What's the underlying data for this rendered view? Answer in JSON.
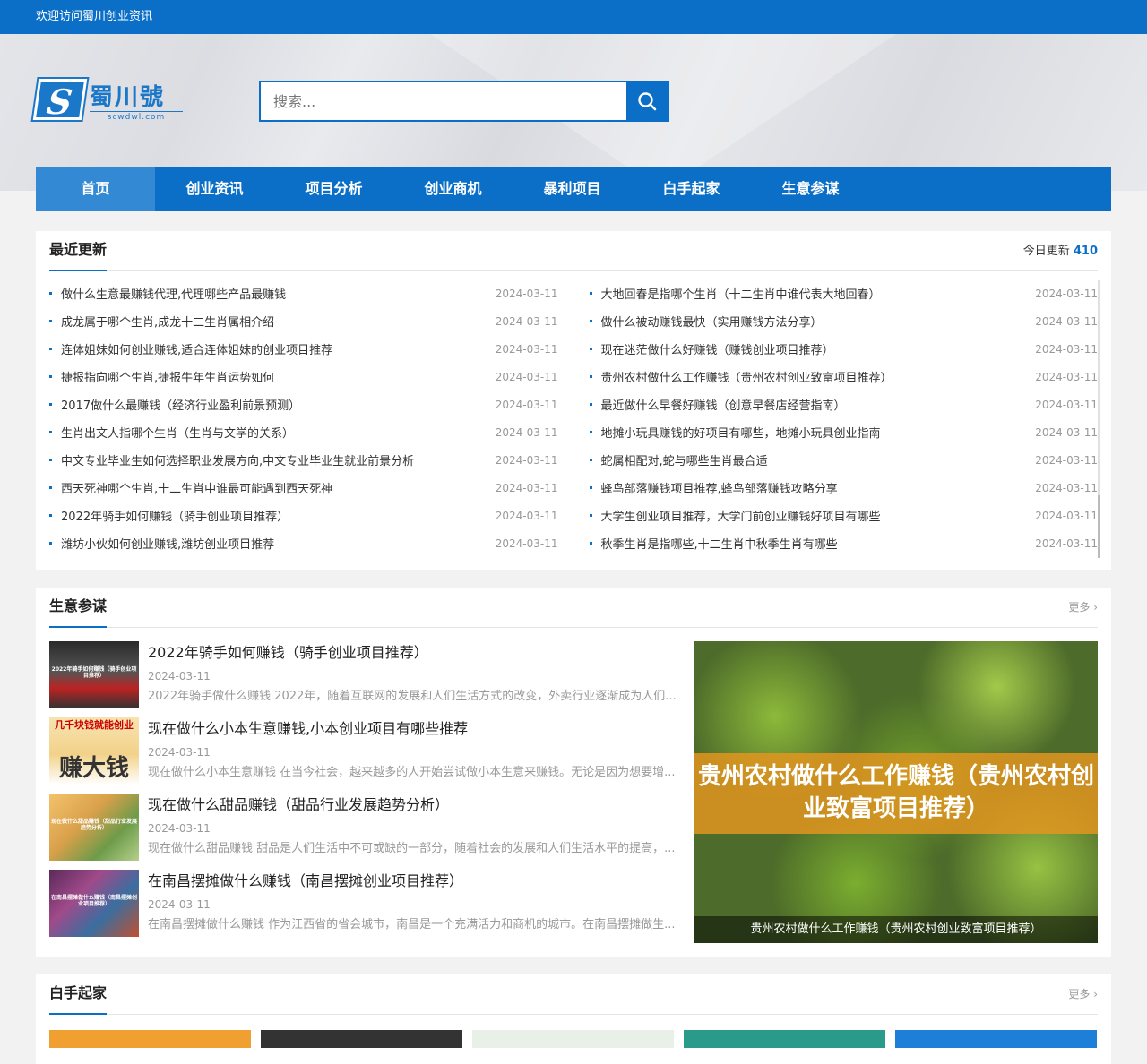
{
  "topbar": {
    "welcome": "欢迎访问蜀川创业资讯"
  },
  "logo": {
    "mark": "S",
    "name": "蜀川號",
    "domain": "scwdwl.com"
  },
  "search": {
    "placeholder": "搜索..."
  },
  "nav": [
    "首页",
    "创业资讯",
    "项目分析",
    "创业商机",
    "暴利项目",
    "白手起家",
    "生意参谋"
  ],
  "recent": {
    "title": "最近更新",
    "today_label": "今日更新",
    "today_count": "410",
    "left": [
      {
        "title": "做什么生意最赚钱代理,代理哪些产品最赚钱",
        "date": "2024-03-11"
      },
      {
        "title": "成龙属于哪个生肖,成龙十二生肖属相介绍",
        "date": "2024-03-11"
      },
      {
        "title": "连体姐妹如何创业赚钱,适合连体姐妹的创业项目推荐",
        "date": "2024-03-11"
      },
      {
        "title": "捷报指向哪个生肖,捷报牛年生肖运势如何",
        "date": "2024-03-11"
      },
      {
        "title": "2017做什么最赚钱（经济行业盈利前景预测）",
        "date": "2024-03-11"
      },
      {
        "title": "生肖出文人指哪个生肖（生肖与文学的关系）",
        "date": "2024-03-11"
      },
      {
        "title": "中文专业毕业生如何选择职业发展方向,中文专业毕业生就业前景分析",
        "date": "2024-03-11"
      },
      {
        "title": "西天死神哪个生肖,十二生肖中谁最可能遇到西天死神",
        "date": "2024-03-11"
      },
      {
        "title": "2022年骑手如何赚钱（骑手创业项目推荐）",
        "date": "2024-03-11"
      },
      {
        "title": "潍坊小伙如何创业赚钱,潍坊创业项目推荐",
        "date": "2024-03-11"
      }
    ],
    "right": [
      {
        "title": "大地回春是指哪个生肖（十二生肖中谁代表大地回春）",
        "date": "2024-03-11"
      },
      {
        "title": "做什么被动赚钱最快（实用赚钱方法分享）",
        "date": "2024-03-11"
      },
      {
        "title": "现在迷茫做什么好赚钱（赚钱创业项目推荐）",
        "date": "2024-03-11"
      },
      {
        "title": "贵州农村做什么工作赚钱（贵州农村创业致富项目推荐）",
        "date": "2024-03-11"
      },
      {
        "title": "最近做什么早餐好赚钱（创意早餐店经营指南）",
        "date": "2024-03-11"
      },
      {
        "title": "地摊小玩具赚钱的好项目有哪些，地摊小玩具创业指南",
        "date": "2024-03-11"
      },
      {
        "title": "蛇属相配对,蛇与哪些生肖最合适",
        "date": "2024-03-11"
      },
      {
        "title": "蜂鸟部落赚钱项目推荐,蜂鸟部落赚钱攻略分享",
        "date": "2024-03-11"
      },
      {
        "title": "大学生创业项目推荐，大学门前创业赚钱好项目有哪些",
        "date": "2024-03-11"
      },
      {
        "title": "秋季生肖是指哪些,十二生肖中秋季生肖有哪些",
        "date": "2024-03-11"
      }
    ]
  },
  "biz": {
    "title": "生意参谋",
    "more": "更多",
    "items": [
      {
        "title": "2022年骑手如何赚钱（骑手创业项目推荐）",
        "date": "2024-03-11",
        "summary": "2022年骑手做什么赚钱 2022年，随着互联网的发展和人们生活方式的改变，外卖行业逐渐成为人们...",
        "thumb_text": "2022年骑手如何赚钱（骑手创业项目推荐）"
      },
      {
        "title": "现在做什么小本生意赚钱,小本创业项目有哪些推荐",
        "date": "2024-03-11",
        "summary": "现在做什么小本生意赚钱 在当今社会，越来越多的人开始尝试做小本生意来赚钱。无论是因为想要增...",
        "thumb_text": "几千块钱就能创业",
        "thumb_big": "赚大钱"
      },
      {
        "title": "现在做什么甜品赚钱（甜品行业发展趋势分析）",
        "date": "2024-03-11",
        "summary": "现在做什么甜品赚钱 甜品是人们生活中不可或缺的一部分，随着社会的发展和人们生活水平的提高，...",
        "thumb_text": "现在做什么甜品赚钱（甜品行业发展趋势分析）"
      },
      {
        "title": "在南昌摆摊做什么赚钱（南昌摆摊创业项目推荐）",
        "date": "2024-03-11",
        "summary": "在南昌摆摊做什么赚钱 作为江西省的省会城市，南昌是一个充满活力和商机的城市。在南昌摆摊做生...",
        "thumb_text": "在南昌摆摊做什么赚钱（南昌摆摊创业项目推荐）"
      }
    ],
    "feature": {
      "band": "贵州农村做什么工作赚钱（贵州农村创业致富项目推荐）",
      "caption": "贵州农村做什么工作赚钱（贵州农村创业致富项目推荐）"
    }
  },
  "start": {
    "title": "白手起家",
    "more": "更多"
  },
  "colors": {
    "brand": "#0b6fc7",
    "nav_active": "#3389d4"
  }
}
